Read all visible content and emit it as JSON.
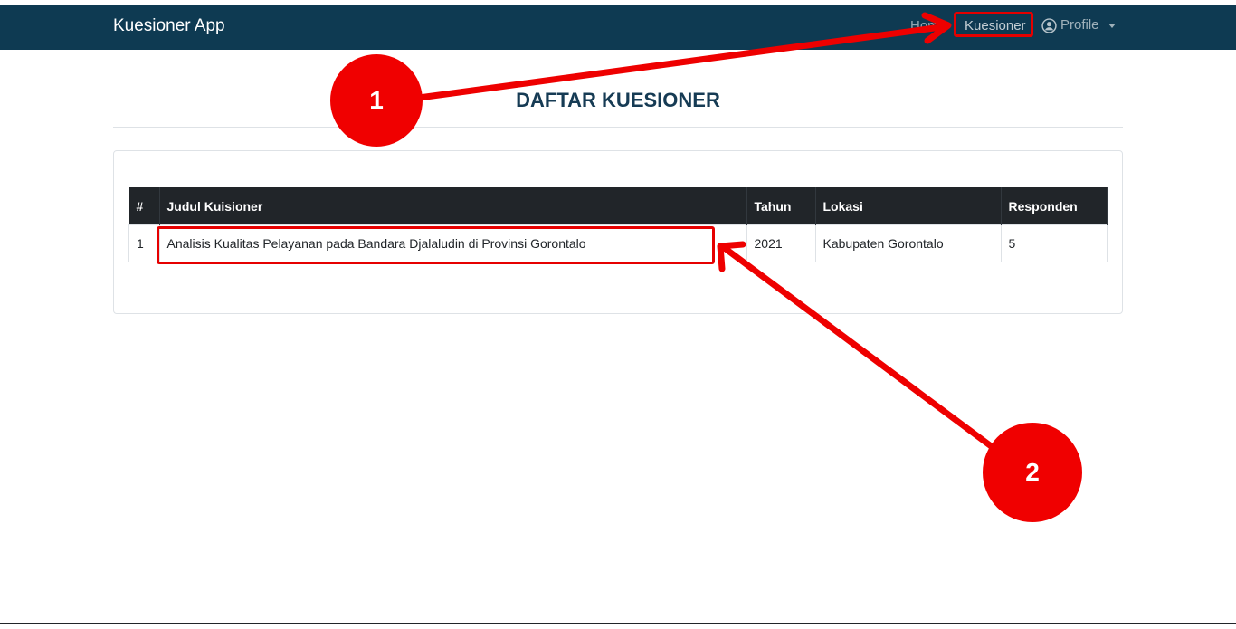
{
  "navbar": {
    "brand": "Kuesioner App",
    "items": [
      {
        "label": "Home"
      },
      {
        "label": "Kuesioner"
      },
      {
        "label": "Profile"
      }
    ]
  },
  "page": {
    "title": "DAFTAR KUESIONER"
  },
  "table": {
    "headers": [
      "#",
      "Judul Kuisioner",
      "Tahun",
      "Lokasi",
      "Responden"
    ],
    "rows": [
      [
        "1",
        "Analisis Kualitas Pelayanan pada Bandara Djalaludin di Provinsi Gorontalo",
        "2021",
        "Kabupaten Gorontalo",
        "5"
      ]
    ]
  },
  "annotations": {
    "marker1": "1",
    "marker2": "2",
    "color": "#e60000"
  },
  "colors": {
    "navbar": "#0e3a52",
    "title": "#163b54",
    "table_header": "#212529"
  }
}
